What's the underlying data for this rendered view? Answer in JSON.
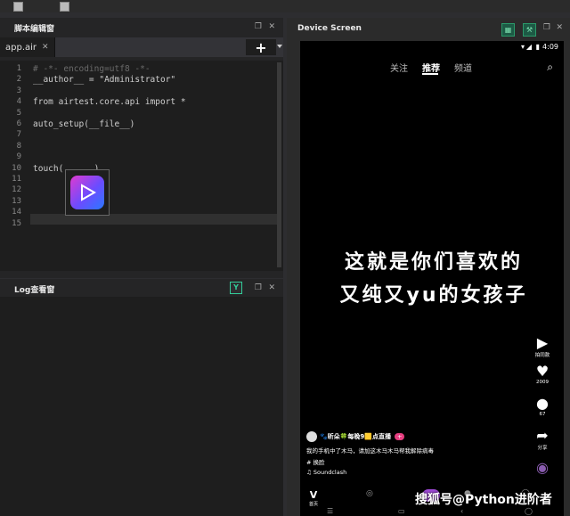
{
  "editor": {
    "title": "脚本编辑窗",
    "tab_label": "app.air",
    "tab_close": "✕",
    "add_label": "+",
    "lines": [
      {
        "n": "1",
        "text": "# -*- encoding=utf8 -*-"
      },
      {
        "n": "2",
        "text": "__author__ = \"Administrator\""
      },
      {
        "n": "3",
        "text": ""
      },
      {
        "n": "4",
        "text": "from airtest.core.api import *"
      },
      {
        "n": "5",
        "text": ""
      },
      {
        "n": "6",
        "text": "auto_setup(__file__)"
      },
      {
        "n": "7",
        "text": ""
      },
      {
        "n": "8",
        "text": ""
      },
      {
        "n": "9",
        "text": ""
      },
      {
        "n": "10",
        "text": "touch(      )"
      },
      {
        "n": "11",
        "text": ""
      },
      {
        "n": "12",
        "text": ""
      },
      {
        "n": "13",
        "text": ""
      },
      {
        "n": "14",
        "text": ""
      },
      {
        "n": "15",
        "text": ""
      }
    ]
  },
  "log": {
    "title": "Log查看窗"
  },
  "device": {
    "title": "Device Screen",
    "status_time": "4:09",
    "nav_tabs": [
      "关注",
      "推荐",
      "频道"
    ],
    "caption_line1": "这就是你们喜欢的",
    "caption_line2": "又纯又yu的女孩子",
    "side": {
      "shoot_label": "拍同款",
      "like_count": "2009",
      "comment_count": "67",
      "share_label": "分享"
    },
    "author": "🐾昕朵🍀每晚9🟨点直播",
    "desc": "我的手机中了木马，请加这木马木马帮我解除病毒",
    "tag": "# 换脸",
    "music": "♫ Soundclash",
    "bottom_active": "首页"
  },
  "watermark": "搜狐号@Python进阶者"
}
